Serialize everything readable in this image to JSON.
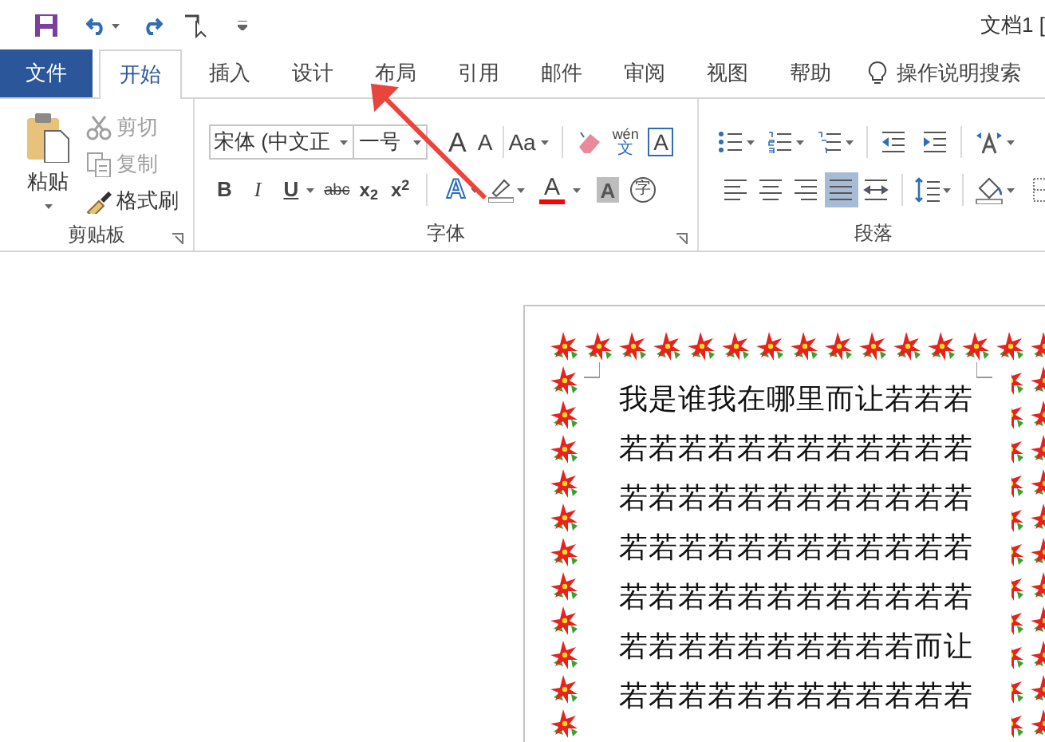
{
  "title": "文档1 [",
  "tabs": [
    {
      "label": "文件",
      "kind": "file",
      "selected": false
    },
    {
      "label": "开始",
      "kind": "tab",
      "selected": true
    },
    {
      "label": "插入",
      "kind": "tab",
      "selected": false
    },
    {
      "label": "设计",
      "kind": "tab",
      "selected": false
    },
    {
      "label": "布局",
      "kind": "tab",
      "selected": false
    },
    {
      "label": "引用",
      "kind": "tab",
      "selected": false
    },
    {
      "label": "邮件",
      "kind": "tab",
      "selected": false
    },
    {
      "label": "审阅",
      "kind": "tab",
      "selected": false
    },
    {
      "label": "视图",
      "kind": "tab",
      "selected": false
    },
    {
      "label": "帮助",
      "kind": "tab",
      "selected": false
    }
  ],
  "tell_me": "操作说明搜索",
  "clipboard": {
    "paste": "粘贴",
    "cut": {
      "label": "剪切",
      "disabled": true
    },
    "copy": {
      "label": "复制",
      "disabled": true
    },
    "format_painter": {
      "label": "格式刷",
      "disabled": false
    },
    "group_label": "剪贴板"
  },
  "font": {
    "name": "宋体 (中文正",
    "size": "一号",
    "grow": "A",
    "shrink": "A",
    "change_case": "Aa",
    "phonetic": "wén",
    "phonetic_char": "文",
    "border_char": "A",
    "bold": "B",
    "italic": "I",
    "underline": "U",
    "strikethrough": "abc",
    "subscript": "x$_{2}$",
    "superscript": "x$^{2}$",
    "text_effect": "A",
    "font_color": "A",
    "char_shading": "A",
    "enclose": "字",
    "group_label": "字体"
  },
  "paragraph": {
    "alignments": [
      {
        "kind": "left",
        "selected": false
      },
      {
        "kind": "center",
        "selected": false
      },
      {
        "kind": "right",
        "selected": false
      },
      {
        "kind": "justify",
        "selected": true
      },
      {
        "kind": "distributed",
        "selected": false
      }
    ],
    "group_label": "段落"
  },
  "document": {
    "lines": [
      "我是谁我在哪里而让若若若",
      "若若若若若若若若若若若若",
      "若若若若若若若若若若若若",
      "若若若若若若若若若若若若",
      "若若若若若若若若若若若若",
      "若若若若若若若若若若而让",
      "若若若若若若若若若若若若"
    ]
  }
}
